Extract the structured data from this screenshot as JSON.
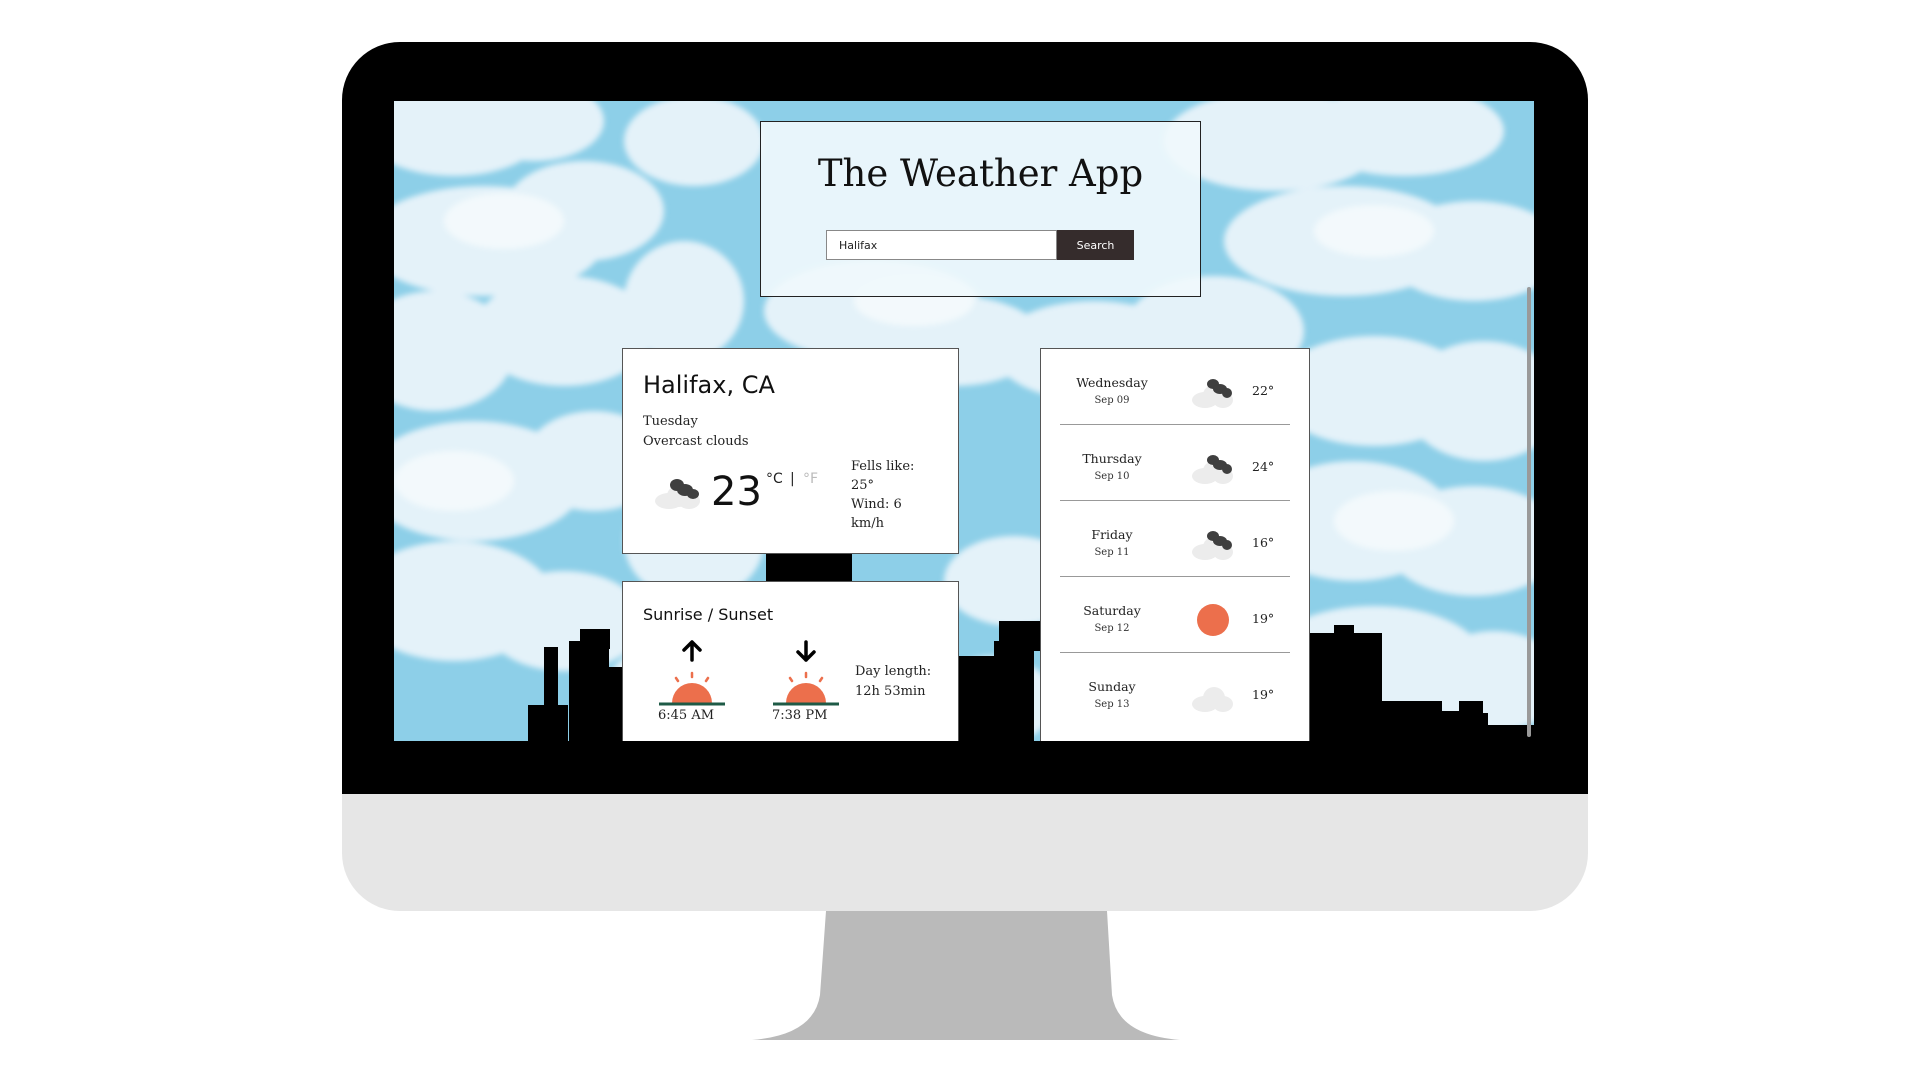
{
  "app": {
    "title": "The Weather App",
    "search": {
      "value": "Halifax",
      "button_label": "Search"
    }
  },
  "current": {
    "city": "Halifax, CA",
    "day": "Tuesday",
    "description": "Overcast clouds",
    "temperature": "23",
    "unit_celsius": "°C",
    "unit_separator": "|",
    "unit_fahrenheit": "°F",
    "feels_like_label": "Fells like:",
    "feels_like_value": "25°",
    "wind_label": "Wind: 6",
    "wind_unit": "km/h",
    "icon": "broken-clouds-icon"
  },
  "sun": {
    "title": "Sunrise / Sunset",
    "sunrise": "6:45 AM",
    "sunset": "7:38 PM",
    "day_length_label": "Day length:",
    "day_length_value": "12h 53min"
  },
  "forecast": [
    {
      "day": "Wednesday",
      "date": "Sep 09",
      "temp": "22°",
      "icon": "broken-clouds-icon"
    },
    {
      "day": "Thursday",
      "date": "Sep 10",
      "temp": "24°",
      "icon": "broken-clouds-icon"
    },
    {
      "day": "Friday",
      "date": "Sep 11",
      "temp": "16°",
      "icon": "broken-clouds-icon"
    },
    {
      "day": "Saturday",
      "date": "Sep 12",
      "temp": "19°",
      "icon": "clear-sky-icon"
    },
    {
      "day": "Sunday",
      "date": "Sep 13",
      "temp": "19°",
      "icon": "few-clouds-icon"
    }
  ],
  "colors": {
    "sky": "#8dcfe8",
    "sun": "#ec6f4c",
    "horizon": "#1e5a46",
    "dark_cloud": "#3f3f3f",
    "button": "#352c2c"
  }
}
